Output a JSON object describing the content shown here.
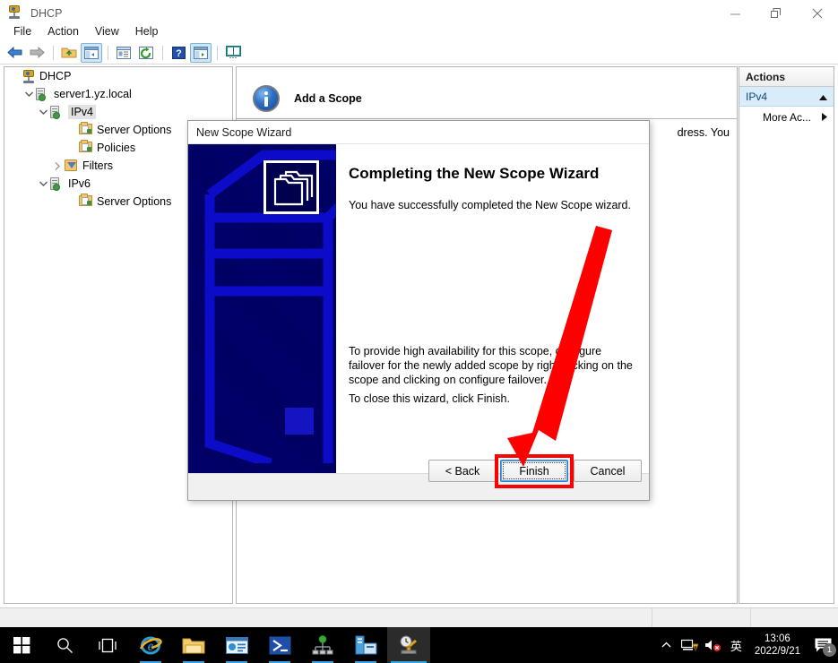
{
  "window": {
    "title": "DHCP",
    "icon": "dhcp-icon",
    "controls": {
      "minimize": "—",
      "restore": "❐",
      "close": "✕"
    }
  },
  "menu": {
    "items": [
      "File",
      "Action",
      "View",
      "Help"
    ]
  },
  "toolbar": {
    "items": [
      {
        "name": "back-icon",
        "selected": false
      },
      {
        "name": "forward-icon",
        "selected": false
      },
      {
        "name": "up-folder-icon",
        "selected": false
      },
      {
        "name": "show-hide-tree-icon",
        "selected": true
      },
      {
        "name": "properties-icon",
        "selected": false
      },
      {
        "name": "refresh-icon",
        "selected": false
      },
      {
        "name": "help-icon",
        "selected": false
      },
      {
        "name": "export-list-icon",
        "selected": true
      },
      {
        "name": "help-book-icon",
        "selected": false
      }
    ]
  },
  "tree": {
    "nodes": [
      {
        "label": "DHCP",
        "indent": 0,
        "chevron": "",
        "icon": "dhcp-icon",
        "selected": false
      },
      {
        "label": "server1.yz.local",
        "indent": 1,
        "chevron": "v",
        "icon": "server-icon",
        "selected": false
      },
      {
        "label": "IPv4",
        "indent": 2,
        "chevron": "v",
        "icon": "server-icon",
        "selected": true
      },
      {
        "label": "Server Options",
        "indent": 4,
        "chevron": "",
        "icon": "folder-icon",
        "selected": false
      },
      {
        "label": "Policies",
        "indent": 4,
        "chevron": "",
        "icon": "folder-icon",
        "selected": false
      },
      {
        "label": "Filters",
        "indent": 3,
        "chevron": ">",
        "icon": "filter-icon",
        "selected": false
      },
      {
        "label": "IPv6",
        "indent": 2,
        "chevron": "v",
        "icon": "server-icon",
        "selected": false
      },
      {
        "label": "Server Options",
        "indent": 4,
        "chevron": "",
        "icon": "folder-icon",
        "selected": false
      }
    ]
  },
  "main": {
    "heading": "Add a Scope",
    "heading_icon": "info-icon",
    "background_text": "dress. You"
  },
  "actions": {
    "header": "Actions",
    "section": {
      "label": "IPv4",
      "collapse_icon": "chevron-up-icon"
    },
    "rows": [
      {
        "label": "More Ac...",
        "submenu_icon": "chevron-right-icon"
      }
    ]
  },
  "dialog": {
    "title": "New Scope Wizard",
    "heading": "Completing the New Scope Wizard",
    "paragraph1": "You have successfully completed the New Scope wizard.",
    "paragraph2": "To provide high availability for this scope, configure failover for the newly added scope by right clicking on the scope and clicking on configure failover.",
    "paragraph3": "To close this wizard, click Finish.",
    "banner_icon": "folder-stack-icon",
    "buttons": {
      "back": "< Back",
      "finish": "Finish",
      "cancel": "Cancel"
    }
  },
  "annotation": {
    "color": "#ff0000",
    "target": "finish-button"
  },
  "taskbar": {
    "items": [
      {
        "name": "start-button",
        "state": "idle"
      },
      {
        "name": "search-icon",
        "state": "idle"
      },
      {
        "name": "task-view-icon",
        "state": "idle"
      },
      {
        "name": "internet-explorer-icon",
        "state": "running"
      },
      {
        "name": "file-explorer-icon",
        "state": "running"
      },
      {
        "name": "server-manager-icon",
        "state": "running"
      },
      {
        "name": "powershell-icon",
        "state": "running"
      },
      {
        "name": "network-tool-icon",
        "state": "running"
      },
      {
        "name": "server-tool-icon",
        "state": "running"
      },
      {
        "name": "dhcp-app-icon",
        "state": "active"
      }
    ],
    "tray": {
      "overflow_icon": "chevron-up-icon",
      "network_icon": "network-warning-icon",
      "volume_icon": "volume-muted-icon",
      "ime": "英",
      "time": "13:06",
      "date": "2022/9/21",
      "notification_icon": "notification-icon",
      "notification_count": "1"
    }
  }
}
